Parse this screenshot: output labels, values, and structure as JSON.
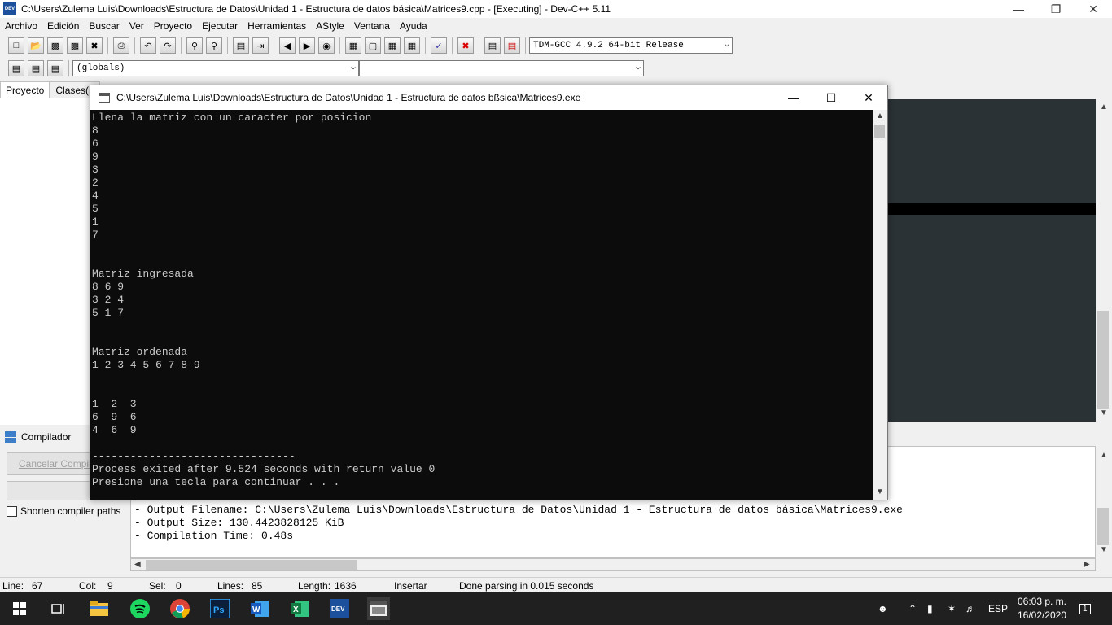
{
  "ide": {
    "title": "C:\\Users\\Zulema Luis\\Downloads\\Estructura de Datos\\Unidad 1 - Estructura de datos básica\\Matrices9.cpp - [Executing] - Dev-C++ 5.11",
    "icon_label": "DEV",
    "menu": [
      "Archivo",
      "Edición",
      "Buscar",
      "Ver",
      "Proyecto",
      "Ejecutar",
      "Herramientas",
      "AStyle",
      "Ventana",
      "Ayuda"
    ],
    "compiler_select": "TDM-GCC 4.9.2 64-bit Release",
    "scope_select": "(globals)",
    "left_tabs": [
      "Proyecto",
      "Clases(F"
    ],
    "bottom_tab": "Compilador",
    "cancel_button": "Cancelar Compil",
    "shorten_label": "Shorten compiler paths",
    "log_lines": [
      "- Output Filename: C:\\Users\\Zulema Luis\\Downloads\\Estructura de Datos\\Unidad 1 - Estructura de datos básica\\Matrices9.exe",
      "- Output Size: 130.4423828125 KiB",
      "- Compilation Time: 0.48s"
    ]
  },
  "status": {
    "line_label": "Line:",
    "line_value": "67",
    "col_label": "Col:",
    "col_value": "9",
    "sel_label": "Sel:",
    "sel_value": "0",
    "lines_label": "Lines:",
    "lines_value": "85",
    "length_label": "Length:",
    "length_value": "1636",
    "mode": "Insertar",
    "message": "Done parsing in 0.015 seconds"
  },
  "console": {
    "title": "C:\\Users\\Zulema Luis\\Downloads\\Estructura de Datos\\Unidad 1 - Estructura de datos bßsica\\Matrices9.exe",
    "output": "Llena la matriz con un caracter por posicion\n8\n6\n9\n3\n2\n4\n5\n1\n7\n\n\nMatriz ingresada\n8 6 9\n3 2 4\n5 1 7\n\n\nMatriz ordenada\n1 2 3 4 5 6 7 8 9\n\n\n1  2  3\n6  9  6\n4  6  9\n\n--------------------------------\nProcess exited after 9.524 seconds with return value 0\nPresione una tecla para continuar . . ."
  },
  "taskbar": {
    "lang": "ESP",
    "time": "06:03 p. m.",
    "date": "16/02/2020",
    "notifications": "1"
  },
  "colors": {
    "console_bg": "#0c0c0c",
    "console_text": "#cccccc",
    "editor_bg": "#2b3236",
    "taskbar_bg": "#202020"
  }
}
